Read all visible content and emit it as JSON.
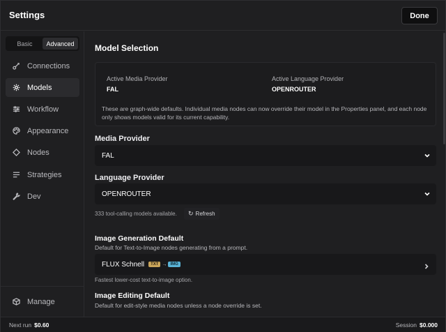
{
  "header": {
    "title": "Settings",
    "done_label": "Done"
  },
  "sidebar": {
    "mode_tabs": [
      {
        "label": "Basic",
        "active": false
      },
      {
        "label": "Advanced",
        "active": true
      }
    ],
    "items": [
      {
        "label": "Connections",
        "icon": "link-icon",
        "active": false
      },
      {
        "label": "Models",
        "icon": "gear-icon",
        "active": true
      },
      {
        "label": "Workflow",
        "icon": "sliders-icon",
        "active": false
      },
      {
        "label": "Appearance",
        "icon": "palette-icon",
        "active": false
      },
      {
        "label": "Nodes",
        "icon": "diamond-icon",
        "active": false
      },
      {
        "label": "Strategies",
        "icon": "list-icon",
        "active": false
      },
      {
        "label": "Dev",
        "icon": "wrench-icon",
        "active": false
      }
    ],
    "manage": {
      "label": "Manage",
      "icon": "cube-icon"
    }
  },
  "main": {
    "section_title": "Model Selection",
    "info": {
      "media_label": "Active Media Provider",
      "media_value": "FAL",
      "language_label": "Active Language Provider",
      "language_value": "OPENROUTER",
      "note": "These are graph-wide defaults. Individual media nodes can now override their model in the Properties panel, and each node only shows models valid for its current capability."
    },
    "media_provider": {
      "label": "Media Provider",
      "value": "FAL"
    },
    "language_provider": {
      "label": "Language Provider",
      "value": "OPENROUTER"
    },
    "models_status": "333 tool-calling models available.",
    "refresh_label": "Refresh",
    "image_generation": {
      "title": "Image Generation Default",
      "description": "Default for Text-to-Image nodes generating from a prompt.",
      "model": "FLUX Schnell",
      "badge_in": "TXT",
      "badge_arrow": "→",
      "badge_out": "IMG",
      "hint": "Fastest lower-cost text-to-image option."
    },
    "image_editing": {
      "title": "Image Editing Default",
      "description": "Default for edit-style media nodes unless a node override is set."
    }
  },
  "footer": {
    "next_run_label": "Next run",
    "next_run_value": "$0.60",
    "session_label": "Session",
    "session_value": "$0.000"
  },
  "colors": {
    "background": "#1f1f21",
    "panel": "#18181a",
    "text": "#ffffff",
    "muted": "#b6b6ba",
    "badge_txt": "#c9a45a",
    "badge_img": "#5ab3d6"
  }
}
